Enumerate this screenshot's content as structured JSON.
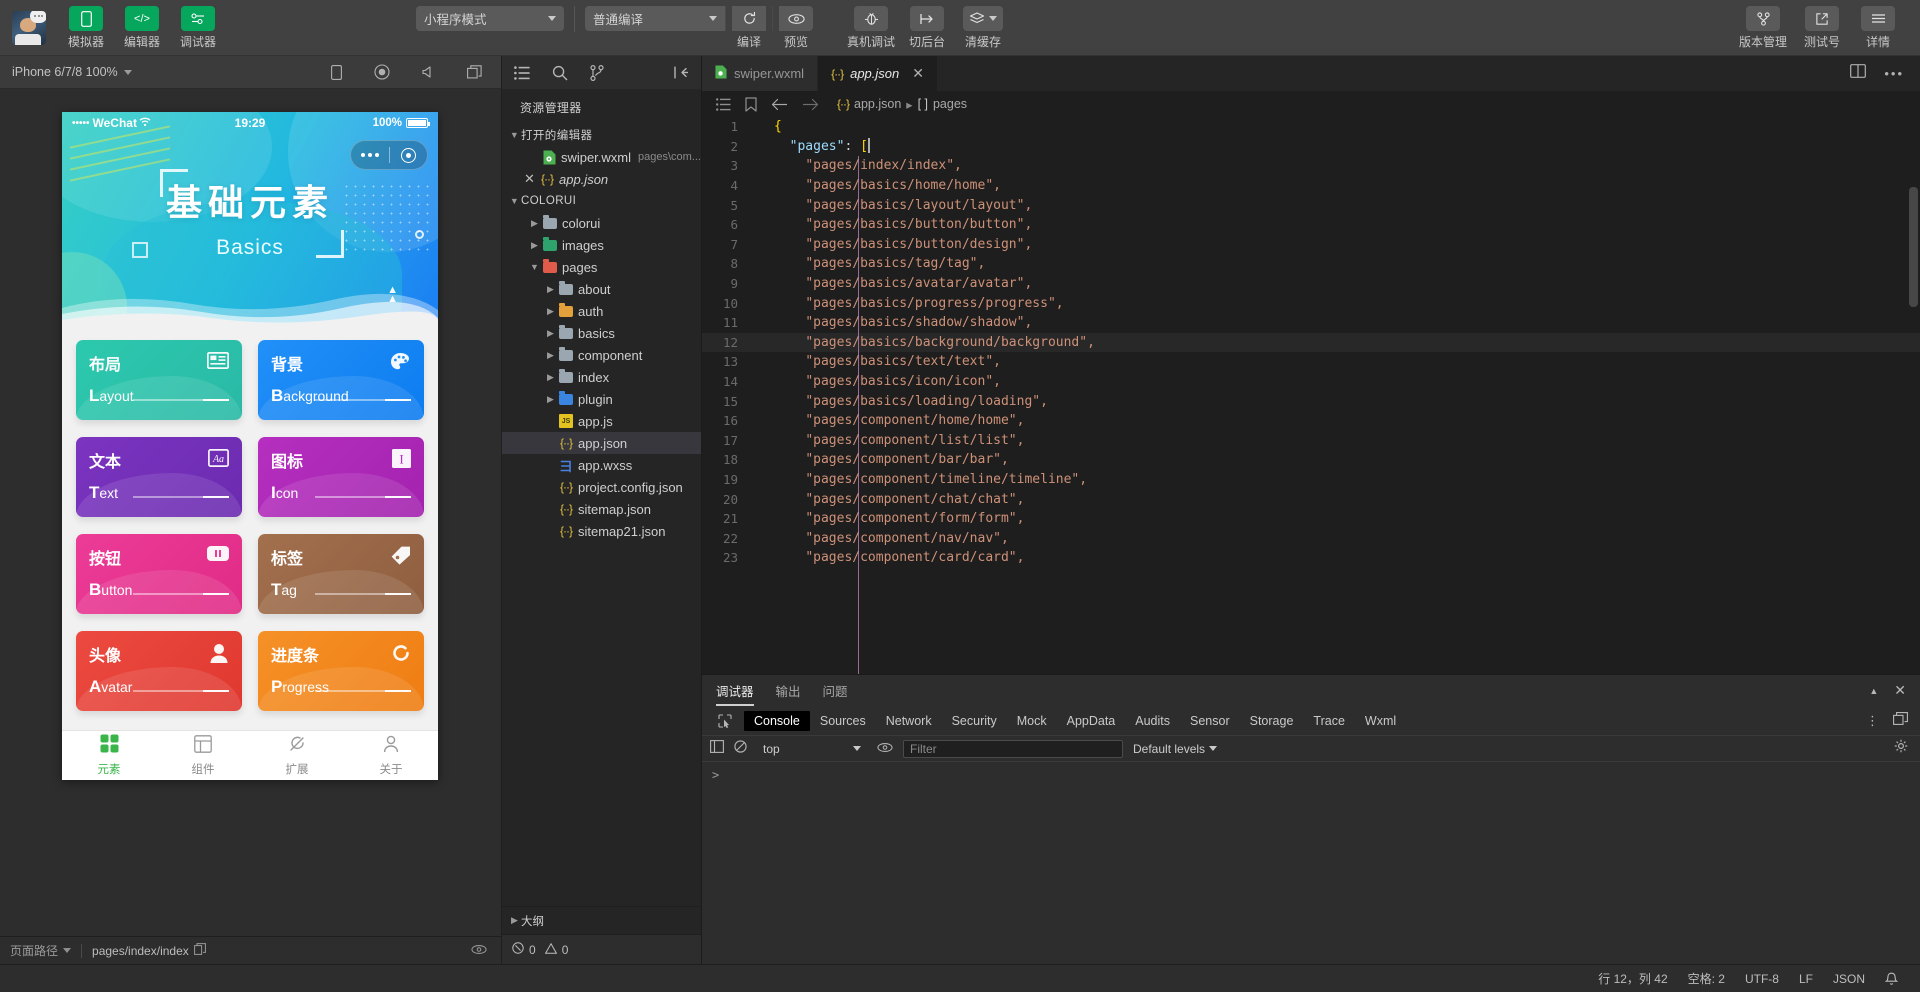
{
  "toolbar": {
    "left_buttons": [
      {
        "name": "simulator",
        "label": "模拟器",
        "icon": "phone-icon"
      },
      {
        "name": "editor",
        "label": "编辑器",
        "icon": "code-icon"
      },
      {
        "name": "debugger",
        "label": "调试器",
        "icon": "debug-icon"
      }
    ],
    "mode_select": "小程序模式",
    "compile_select": "普通编译",
    "compile_label": "编译",
    "preview_label": "预览",
    "center_buttons": [
      {
        "name": "real-device-debug",
        "label": "真机调试",
        "icon": "bug-icon"
      },
      {
        "name": "switch-background",
        "label": "切后台",
        "icon": "background-icon"
      },
      {
        "name": "clear-cache",
        "label": "清缓存",
        "icon": "layers-icon"
      }
    ],
    "right_buttons": [
      {
        "name": "version-manage",
        "label": "版本管理",
        "icon": "branch-icon"
      },
      {
        "name": "test-number",
        "label": "测试号",
        "icon": "external-link-icon"
      },
      {
        "name": "details",
        "label": "详情",
        "icon": "hamburger-icon"
      }
    ]
  },
  "simulator": {
    "device": "iPhone 6/7/8 100%",
    "icons": [
      "phone-rotate-icon",
      "record-icon",
      "volume-icon",
      "window-icon"
    ],
    "phone": {
      "status_bar": {
        "dots": "•••••",
        "carrier": "WeChat",
        "wifi": "wifi-icon",
        "time": "19:29",
        "battery": "100%"
      },
      "hero": {
        "title_cn": "基础元素",
        "title_en": "Basics"
      },
      "cards": [
        {
          "cn": "布局",
          "en_first": "L",
          "en_rest": "ayout",
          "color1": "#2cc9ae",
          "color2": "#2fbfa8",
          "icon": "layout-icon"
        },
        {
          "cn": "背景",
          "en_first": "B",
          "en_rest": "ackground",
          "color1": "#1f8cf5",
          "color2": "#0d7ef0",
          "icon": "palette-icon"
        },
        {
          "cn": "文本",
          "en_first": "T",
          "en_rest": "ext",
          "color1": "#7b34c0",
          "color2": "#6f2fb5",
          "icon": "text-icon"
        },
        {
          "cn": "图标",
          "en_first": "I",
          "en_rest": "con",
          "color1": "#b62fc0",
          "color2": "#a926b2",
          "icon": "icon-icon"
        },
        {
          "cn": "按钮",
          "en_first": "B",
          "en_rest": "utton",
          "color1": "#e7338f",
          "color2": "#df2b87",
          "icon": "button-icon"
        },
        {
          "cn": "标签",
          "en_first": "T",
          "en_rest": "ag",
          "color1": "#9e6b4a",
          "color2": "#8f5f40",
          "icon": "tag-icon"
        },
        {
          "cn": "头像",
          "en_first": "A",
          "en_rest": "vatar",
          "color1": "#e8483f",
          "color2": "#e03a31",
          "icon": "avatar-icon"
        },
        {
          "cn": "进度条",
          "en_first": "P",
          "en_rest": "rogress",
          "color1": "#f28a22",
          "color2": "#ef7e14",
          "icon": "progress-icon"
        }
      ],
      "tabbar": [
        {
          "label": "元素",
          "icon": "elements-icon",
          "active": true
        },
        {
          "label": "组件",
          "icon": "components-icon",
          "active": false
        },
        {
          "label": "扩展",
          "icon": "plugin-icon",
          "active": false
        },
        {
          "label": "关于",
          "icon": "about-icon",
          "active": false
        }
      ]
    }
  },
  "explorer": {
    "actions": [
      "explorer-icon",
      "search-icon",
      "source-control-icon",
      "collapse-icon"
    ],
    "title": "资源管理器",
    "open_editors": {
      "label": "打开的编辑器",
      "items": [
        {
          "name": "swiper.wxml",
          "detail": "pages\\com...",
          "icon": "wxml-file-icon",
          "closable": false
        },
        {
          "name": "app.json",
          "detail": "",
          "icon": "json-file-icon",
          "closable": true,
          "italic": true
        }
      ]
    },
    "project": {
      "label": "COLORUI",
      "items": [
        {
          "label": "colorui",
          "type": "folder",
          "color": "grey",
          "depth": 1,
          "expanded": false
        },
        {
          "label": "images",
          "type": "folder",
          "color": "green",
          "depth": 1,
          "expanded": false
        },
        {
          "label": "pages",
          "type": "folder",
          "color": "red",
          "depth": 1,
          "expanded": true
        },
        {
          "label": "about",
          "type": "folder",
          "color": "grey",
          "depth": 2,
          "expanded": false
        },
        {
          "label": "auth",
          "type": "folder",
          "color": "yellow",
          "depth": 2,
          "expanded": false
        },
        {
          "label": "basics",
          "type": "folder",
          "color": "grey",
          "depth": 2,
          "expanded": false
        },
        {
          "label": "component",
          "type": "folder",
          "color": "grey",
          "depth": 2,
          "expanded": false
        },
        {
          "label": "index",
          "type": "folder",
          "color": "grey",
          "depth": 2,
          "expanded": false
        },
        {
          "label": "plugin",
          "type": "folder",
          "color": "blue",
          "depth": 2,
          "expanded": false
        },
        {
          "label": "app.js",
          "type": "js",
          "depth": 2,
          "expanded": null
        },
        {
          "label": "app.json",
          "type": "json",
          "depth": 2,
          "selected": true
        },
        {
          "label": "app.wxss",
          "type": "wxss",
          "depth": 2
        },
        {
          "label": "project.config.json",
          "type": "json",
          "depth": 2
        },
        {
          "label": "sitemap.json",
          "type": "json",
          "depth": 2
        },
        {
          "label": "sitemap21.json",
          "type": "json",
          "depth": 2
        }
      ]
    },
    "outline": "大纲",
    "problems": {
      "errors": "0",
      "warnings": "0"
    }
  },
  "editor": {
    "tabs": [
      {
        "label": "swiper.wxml",
        "icon": "wxml-file-icon",
        "active": false
      },
      {
        "label": "app.json",
        "icon": "json-file-icon",
        "active": true,
        "italic": true
      }
    ],
    "breadcrumb": {
      "file": "app.json",
      "node": "pages"
    },
    "nav_icons": [
      "outline-icon",
      "bookmark-icon",
      "back-arrow-icon",
      "forward-arrow-icon"
    ],
    "split_icon": "split-editor-icon",
    "more_icon": "more-icon",
    "highlight_line": 12,
    "lines": [
      {
        "n": 1,
        "text": "{",
        "type": "brace"
      },
      {
        "n": 2,
        "text": "\"pages\": [",
        "type": "keyopen"
      },
      {
        "n": 3,
        "text": "\"pages/index/index\",",
        "type": "str"
      },
      {
        "n": 4,
        "text": "\"pages/basics/home/home\",",
        "type": "str"
      },
      {
        "n": 5,
        "text": "\"pages/basics/layout/layout\",",
        "type": "str"
      },
      {
        "n": 6,
        "text": "\"pages/basics/button/button\",",
        "type": "str"
      },
      {
        "n": 7,
        "text": "\"pages/basics/button/design\",",
        "type": "str"
      },
      {
        "n": 8,
        "text": "\"pages/basics/tag/tag\",",
        "type": "str"
      },
      {
        "n": 9,
        "text": "\"pages/basics/avatar/avatar\",",
        "type": "str"
      },
      {
        "n": 10,
        "text": "\"pages/basics/progress/progress\",",
        "type": "str"
      },
      {
        "n": 11,
        "text": "\"pages/basics/shadow/shadow\",",
        "type": "str"
      },
      {
        "n": 12,
        "text": "\"pages/basics/background/background\",",
        "type": "str"
      },
      {
        "n": 13,
        "text": "\"pages/basics/text/text\",",
        "type": "str"
      },
      {
        "n": 14,
        "text": "\"pages/basics/icon/icon\",",
        "type": "str"
      },
      {
        "n": 15,
        "text": "\"pages/basics/loading/loading\",",
        "type": "str"
      },
      {
        "n": 16,
        "text": "\"pages/component/home/home\",",
        "type": "str"
      },
      {
        "n": 17,
        "text": "\"pages/component/list/list\",",
        "type": "str"
      },
      {
        "n": 18,
        "text": "\"pages/component/bar/bar\",",
        "type": "str"
      },
      {
        "n": 19,
        "text": "\"pages/component/timeline/timeline\",",
        "type": "str"
      },
      {
        "n": 20,
        "text": "\"pages/component/chat/chat\",",
        "type": "str"
      },
      {
        "n": 21,
        "text": "\"pages/component/form/form\",",
        "type": "str"
      },
      {
        "n": 22,
        "text": "\"pages/component/nav/nav\",",
        "type": "str"
      },
      {
        "n": 23,
        "text": "\"pages/component/card/card\",",
        "type": "str"
      }
    ]
  },
  "devtools": {
    "tabs": [
      {
        "label": "调试器",
        "active": true
      },
      {
        "label": "输出",
        "active": false
      },
      {
        "label": "问题",
        "active": false
      }
    ],
    "collapse_icon": "chevron-up-icon",
    "close_icon": "close-icon",
    "panels": [
      {
        "label": "Console",
        "active": true
      },
      {
        "label": "Sources",
        "active": false
      },
      {
        "label": "Network",
        "active": false
      },
      {
        "label": "Security",
        "active": false
      },
      {
        "label": "Mock",
        "active": false
      },
      {
        "label": "AppData",
        "active": false
      },
      {
        "label": "Audits",
        "active": false
      },
      {
        "label": "Sensor",
        "active": false
      },
      {
        "label": "Storage",
        "active": false
      },
      {
        "label": "Trace",
        "active": false
      },
      {
        "label": "Wxml",
        "active": false
      }
    ],
    "picker_icon": "inspect-icon",
    "more_icon": "kebab-icon",
    "dock_icon": "dock-icon",
    "settings_icon": "gear-icon",
    "filterbar": {
      "execute_icon": "sidebar-icon",
      "clear_icon": "clear-icon",
      "context": "top",
      "eye_icon": "eye-icon",
      "filter_placeholder": "Filter",
      "levels": "Default levels"
    },
    "prompt": ">"
  },
  "status_bar": {
    "page_path_label": "页面路径",
    "page_path_value": "pages/index/index",
    "copy_icon": "copy-icon",
    "eye_icon": "eye-icon",
    "errors": "0",
    "warnings": "0",
    "cursor": "行 12，列 42",
    "indent": "空格: 2",
    "encoding": "UTF-8",
    "eol": "LF",
    "language": "JSON",
    "bell_icon": "bell-icon"
  },
  "colors": {
    "accent_green": "#07a65d",
    "toolbar_bg": "#414141",
    "editor_bg": "#1e1e1e",
    "sidebar_bg": "#252526",
    "string": "#ce9178",
    "key": "#9cdcfe"
  }
}
